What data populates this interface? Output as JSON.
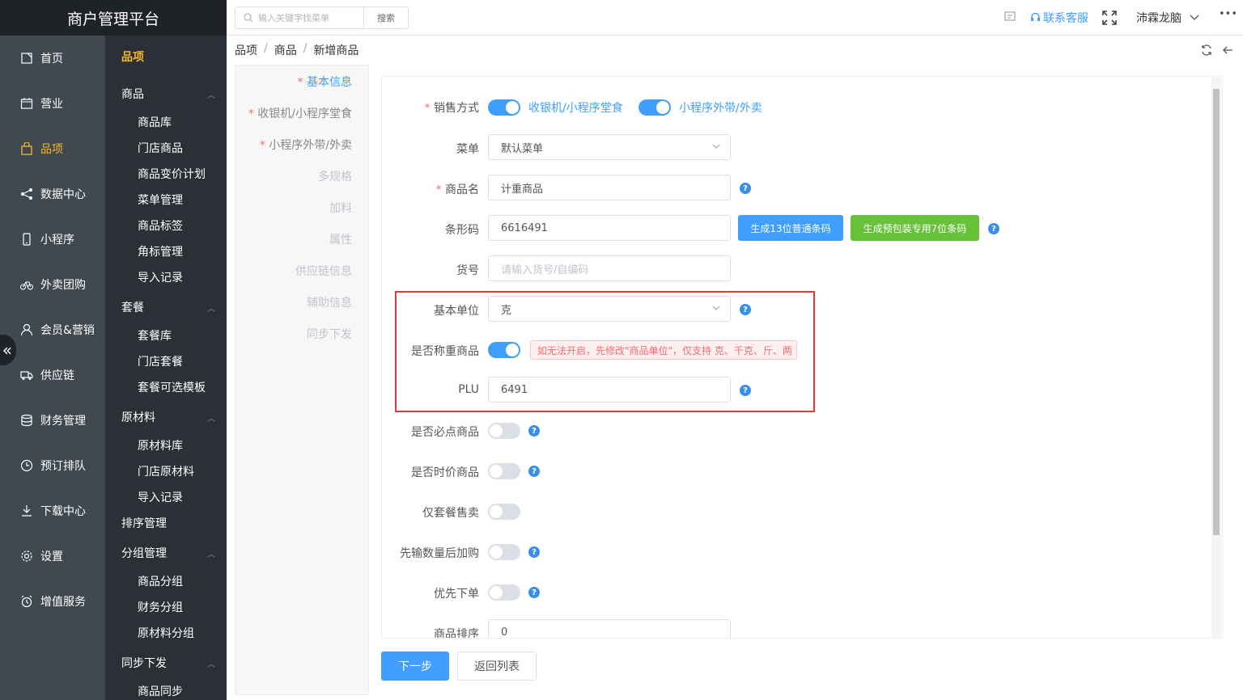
{
  "app": {
    "title": "商户管理平台"
  },
  "nav_primary": [
    {
      "label": "首页",
      "icon": "home-icon"
    },
    {
      "label": "营业",
      "icon": "calendar-icon"
    },
    {
      "label": "品项",
      "icon": "bag-icon",
      "active": true
    },
    {
      "label": "数据中心",
      "icon": "share-icon"
    },
    {
      "label": "小程序",
      "icon": "phone-icon"
    },
    {
      "label": "外卖团购",
      "icon": "bike-icon"
    },
    {
      "label": "会员&营销",
      "icon": "user-icon"
    },
    {
      "label": "供应链",
      "icon": "truck-icon"
    },
    {
      "label": "财务管理",
      "icon": "database-icon"
    },
    {
      "label": "预订排队",
      "icon": "clock-icon"
    },
    {
      "label": "下载中心",
      "icon": "download-icon"
    },
    {
      "label": "设置",
      "icon": "gear-icon"
    },
    {
      "label": "增值服务",
      "icon": "alarm-icon"
    }
  ],
  "nav_secondary": {
    "title": "品项",
    "groups": [
      {
        "label": "商品",
        "items": [
          "商品库",
          "门店商品",
          "商品变价计划",
          "菜单管理",
          "商品标签",
          "角标管理",
          "导入记录"
        ]
      },
      {
        "label": "套餐",
        "items": [
          "套餐库",
          "门店套餐",
          "套餐可选模板"
        ]
      },
      {
        "label": "原材料",
        "items": [
          "原材料库",
          "门店原材料",
          "导入记录"
        ]
      },
      {
        "label": "排序管理",
        "items": []
      },
      {
        "label": "分组管理",
        "items": [
          "商品分组",
          "财务分组",
          "原材料分组"
        ]
      },
      {
        "label": "同步下发",
        "items": [
          "商品同步"
        ]
      }
    ]
  },
  "topbar": {
    "search_placeholder": "输入关键字找菜单",
    "search_button": "搜索",
    "support": "联系客服",
    "user": "沛霖龙脑",
    "more": "•••"
  },
  "breadcrumb": [
    "品项",
    "商品",
    "新增商品"
  ],
  "steps": [
    {
      "label": "基本信息",
      "required": true,
      "active": true
    },
    {
      "label": "收银机/小程序堂食",
      "required": true
    },
    {
      "label": "小程序外带/外卖",
      "required": true
    },
    {
      "label": "多规格"
    },
    {
      "label": "加料"
    },
    {
      "label": "属性"
    },
    {
      "label": "供应链信息"
    },
    {
      "label": "辅助信息"
    },
    {
      "label": "同步下发"
    }
  ],
  "form": {
    "sale_mode": {
      "label": "销售方式",
      "opt1": "收银机/小程序堂食",
      "opt2": "小程序外带/外卖"
    },
    "menu": {
      "label": "菜单",
      "value": "默认菜单"
    },
    "name": {
      "label": "商品名",
      "value": "计重商品"
    },
    "barcode": {
      "label": "条形码",
      "value": "6616491",
      "btn1": "生成13位普通条码",
      "btn2": "生成预包装专用7位条码"
    },
    "sku": {
      "label": "货号",
      "placeholder": "请输入货号/自编码"
    },
    "unit": {
      "label": "基本单位",
      "value": "克"
    },
    "weighed": {
      "label": "是否称重商品",
      "warning": "如无法开启，先修改\"商品单位\"，仅支持 克、千克、斤、两"
    },
    "plu": {
      "label": "PLU",
      "value": "6491"
    },
    "must_order": {
      "label": "是否必点商品"
    },
    "market_price": {
      "label": "是否时价商品"
    },
    "combo_only": {
      "label": "仅套餐售卖"
    },
    "qty_first": {
      "label": "先输数量后加购"
    },
    "priority": {
      "label": "优先下单"
    },
    "sort": {
      "label": "商品排序",
      "value": "0"
    }
  },
  "actions": {
    "next": "下一步",
    "back": "返回列表"
  },
  "colors": {
    "primary": "#409eff",
    "green": "#67c23a",
    "active_nav": "#f5b82e",
    "highlight_box": "#e53935"
  }
}
